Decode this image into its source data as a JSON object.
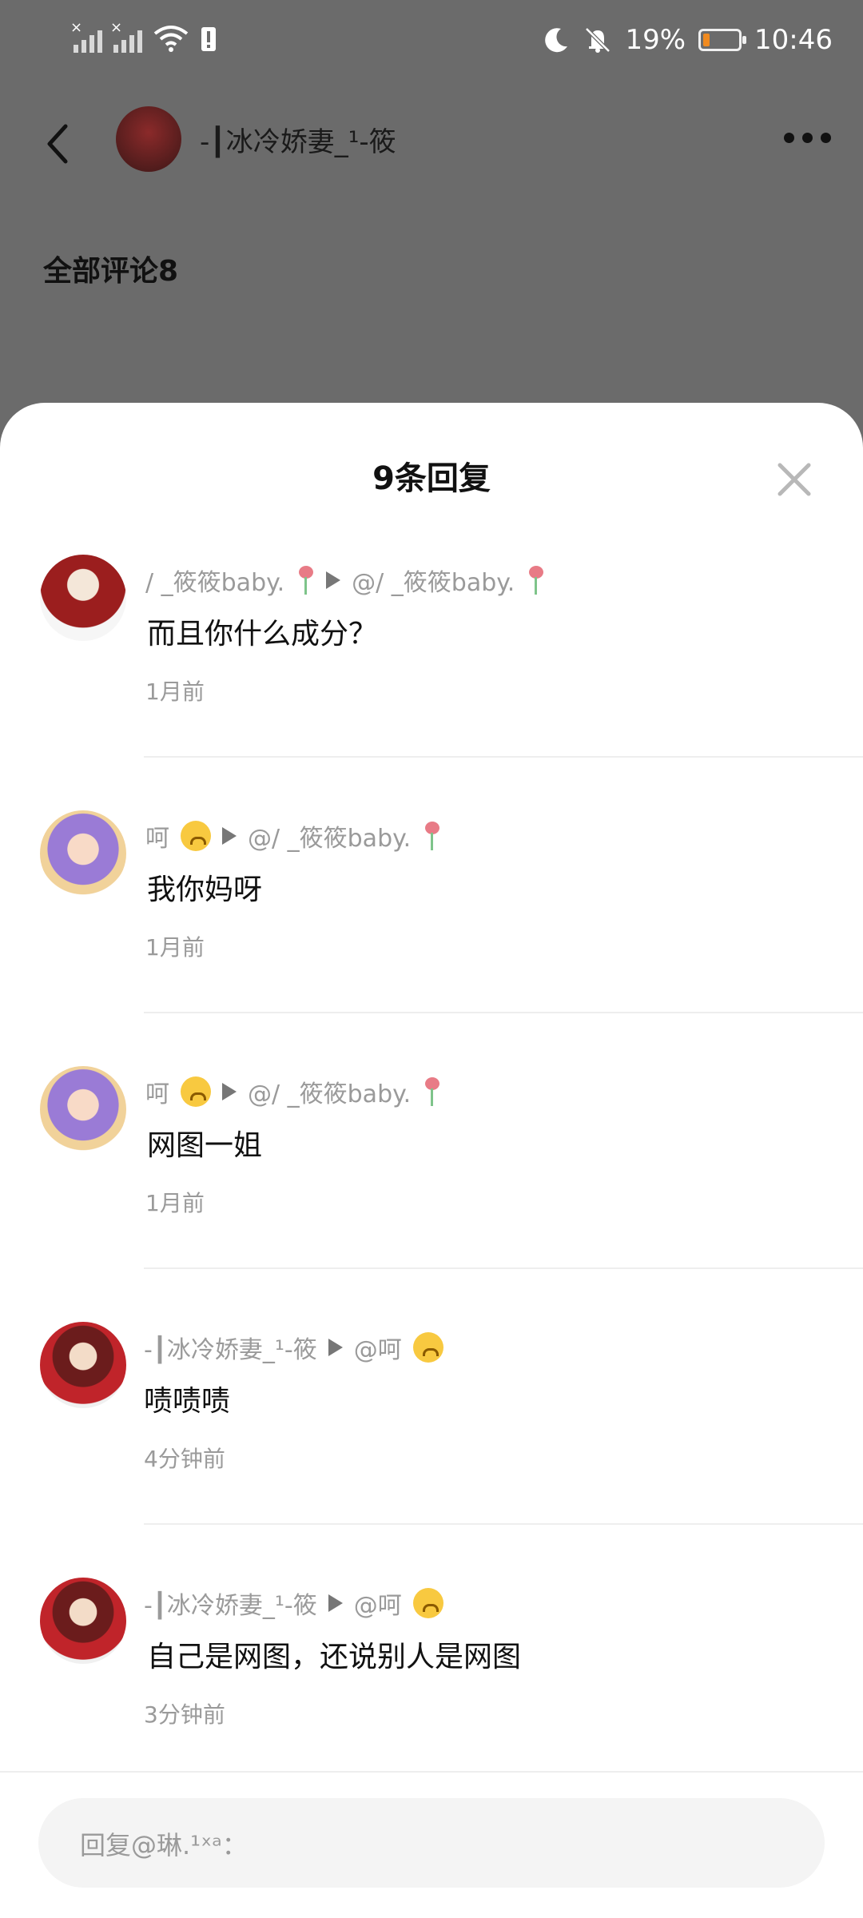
{
  "status_bar": {
    "battery": "19%",
    "time": "10:46",
    "battery_level": 0.19
  },
  "header": {
    "user_name": "-┃冰冷娇妻_¹-筱"
  },
  "section_title": "全部评论8",
  "sheet": {
    "title": "9条回复",
    "comments": [
      {
        "author": "/ _筱筱baby.",
        "target": "@/ _筱筱baby.",
        "text": "而且你什么成分？",
        "time": "1月前"
      },
      {
        "author": "呵",
        "target": "@/ _筱筱baby.",
        "text": "我你妈呀",
        "time": "1月前"
      },
      {
        "author": "呵",
        "target": "@/ _筱筱baby.",
        "text": "网图一姐",
        "time": "1月前"
      },
      {
        "author": "-┃冰冷娇妻_¹-筱",
        "target": "@呵",
        "text": "啧啧啧",
        "time": "4分钟前"
      },
      {
        "author": "-┃冰冷娇妻_¹-筱",
        "target": "@呵",
        "text": "自己是网图，还说别人是网图",
        "time": "3分钟前"
      }
    ]
  },
  "reply_input": {
    "placeholder": "回复@琳.¹ˣᵃ："
  },
  "colors": {
    "overlay": "#6b6b6b",
    "sheet_bg": "#ffffff",
    "battery_fill": "#f08a1f",
    "meta_text": "#9a9a9a"
  }
}
